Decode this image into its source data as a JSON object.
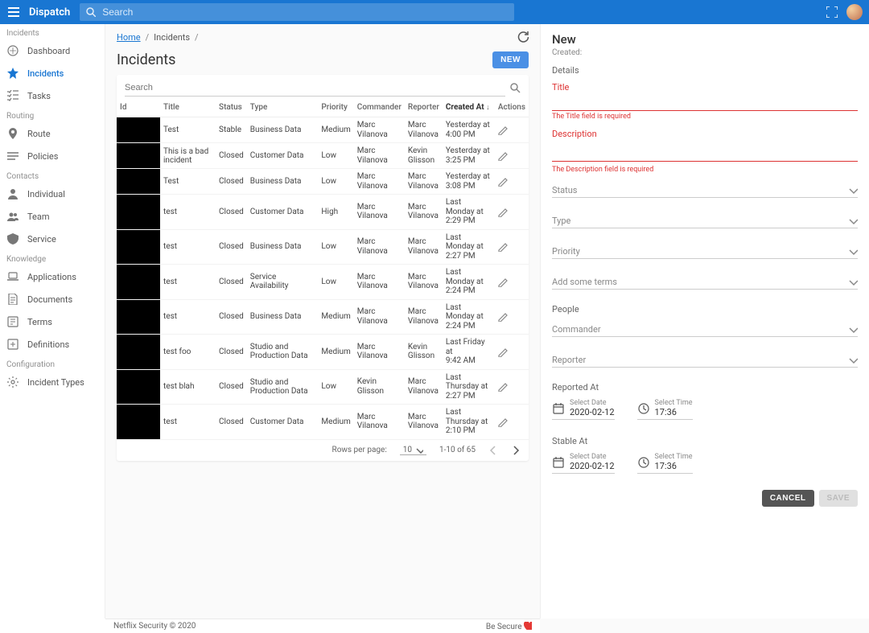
{
  "appbar": {
    "brand": "Dispatch",
    "search_placeholder": "Search"
  },
  "sidebar": {
    "sections": [
      {
        "title": "Incidents",
        "items": [
          {
            "icon": "dashboard",
            "label": "Dashboard"
          },
          {
            "icon": "star",
            "label": "Incidents",
            "active": true
          },
          {
            "icon": "tasks",
            "label": "Tasks"
          }
        ]
      },
      {
        "title": "Routing",
        "items": [
          {
            "icon": "pin",
            "label": "Route"
          },
          {
            "icon": "policies",
            "label": "Policies"
          }
        ]
      },
      {
        "title": "Contacts",
        "items": [
          {
            "icon": "person",
            "label": "Individual"
          },
          {
            "icon": "team",
            "label": "Team"
          },
          {
            "icon": "service",
            "label": "Service"
          }
        ]
      },
      {
        "title": "Knowledge",
        "items": [
          {
            "icon": "laptop",
            "label": "Applications"
          },
          {
            "icon": "doc",
            "label": "Documents"
          },
          {
            "icon": "terms",
            "label": "Terms"
          },
          {
            "icon": "def",
            "label": "Definitions"
          }
        ]
      },
      {
        "title": "Configuration",
        "items": [
          {
            "icon": "gear",
            "label": "Incident Types"
          }
        ]
      }
    ]
  },
  "breadcrumbs": {
    "home": "Home",
    "current": "Incidents"
  },
  "page": {
    "title": "Incidents",
    "new_btn": "NEW"
  },
  "table": {
    "search_placeholder": "Search",
    "columns": [
      "Id",
      "Title",
      "Status",
      "Type",
      "Priority",
      "Commander",
      "Reporter",
      "Created At",
      "Actions"
    ],
    "rows": [
      {
        "title": "Test",
        "status": "Stable",
        "type": "Business Data",
        "priority": "Medium",
        "commander": "Marc Vilanova",
        "reporter": "Marc Vilanova",
        "created": "Yesterday at 4:00 PM"
      },
      {
        "title": "This is a bad incident",
        "status": "Closed",
        "type": "Customer Data",
        "priority": "Low",
        "commander": "Marc Vilanova",
        "reporter": "Kevin Glisson",
        "created": "Yesterday at 3:25 PM"
      },
      {
        "title": "Test",
        "status": "Closed",
        "type": "Business Data",
        "priority": "Low",
        "commander": "Marc Vilanova",
        "reporter": "Marc Vilanova",
        "created": "Yesterday at 3:08 PM"
      },
      {
        "title": "test",
        "status": "Closed",
        "type": "Customer Data",
        "priority": "High",
        "commander": "Marc Vilanova",
        "reporter": "Marc Vilanova",
        "created": "Last Monday at 2:29 PM"
      },
      {
        "title": "test",
        "status": "Closed",
        "type": "Business Data",
        "priority": "Low",
        "commander": "Marc Vilanova",
        "reporter": "Marc Vilanova",
        "created": "Last Monday at 2:27 PM"
      },
      {
        "title": "test",
        "status": "Closed",
        "type": "Service Availability",
        "priority": "Low",
        "commander": "Marc Vilanova",
        "reporter": "Marc Vilanova",
        "created": "Last Monday at 2:24 PM"
      },
      {
        "title": "test",
        "status": "Closed",
        "type": "Business Data",
        "priority": "Medium",
        "commander": "Marc Vilanova",
        "reporter": "Marc Vilanova",
        "created": "Last Monday at 2:24 PM"
      },
      {
        "title": "test foo",
        "status": "Closed",
        "type": "Studio and Production Data",
        "priority": "Medium",
        "commander": "Marc Vilanova",
        "reporter": "Kevin Glisson",
        "created": "Last Friday at 9:42 AM"
      },
      {
        "title": "test blah",
        "status": "Closed",
        "type": "Studio and Production Data",
        "priority": "Low",
        "commander": "Kevin Glisson",
        "reporter": "Marc Vilanova",
        "created": "Last Thursday at 2:27 PM"
      },
      {
        "title": "test",
        "status": "Closed",
        "type": "Customer Data",
        "priority": "Medium",
        "commander": "Marc Vilanova",
        "reporter": "Marc Vilanova",
        "created": "Last Thursday at 2:10 PM"
      }
    ],
    "pager": {
      "rpp_label": "Rows per page:",
      "rpp_value": "10",
      "range": "1-10 of 65"
    }
  },
  "drawer": {
    "heading": "New",
    "created_label": "Created:",
    "details": "Details",
    "title_label": "Title",
    "title_err": "The Title field is required",
    "desc_label": "Description",
    "desc_err": "The Description field is required",
    "status": "Status",
    "type": "Type",
    "priority": "Priority",
    "terms": "Add some terms",
    "people": "People",
    "commander": "Commander",
    "reporter": "Reporter",
    "reported_at": "Reported At",
    "stable_at": "Stable At",
    "select_date": "Select Date",
    "select_time": "Select Time",
    "date_val": "2020-02-12",
    "time_val": "17:36",
    "cancel": "CANCEL",
    "save": "SAVE"
  },
  "footer": {
    "left": "Netflix Security © 2020",
    "right": "Be Secure "
  }
}
